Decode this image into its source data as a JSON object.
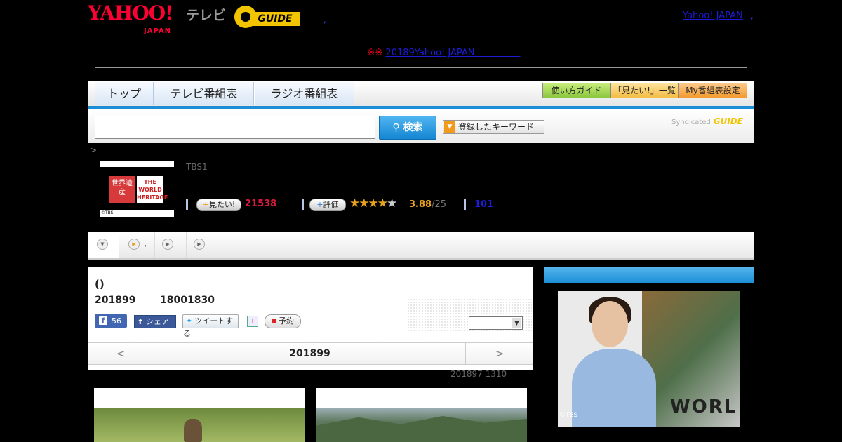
{
  "header": {
    "yahoo_logo": "YAHOO!",
    "yahoo_logo_sub": "JAPAN",
    "tv_label": "テレビ",
    "gguide_logo": "GUIDE",
    "sep1": ",",
    "yahoo_link": "Yahoo! JAPAN",
    "sep2": ","
  },
  "notice": {
    "mark": "※※",
    "link": "20189Yahoo! JAPAN　　　　　"
  },
  "nav": {
    "tabs": [
      "トップ",
      "テレビ番組表",
      "ラジオ番組表"
    ],
    "right_buttons": [
      "使い方ガイド",
      "「見たい!」一覧",
      "My番組表設定"
    ],
    "right_colors": [
      "#9bd04a",
      "#f6c85a",
      "#f4a33c"
    ]
  },
  "search": {
    "input_value": "",
    "select_value": "",
    "button_label": "検索",
    "keyword_button": "登録したキーワード",
    "syndicated": "Syndicated",
    "syndicated_logo": "GUIDE"
  },
  "program": {
    "breadcrumb": ">",
    "thumb_logo_left": "世界遺産",
    "thumb_logo_right": "THE WORLD HERITAGE",
    "thumb_credit": "©TBS",
    "channel": "TBS1",
    "mitai_label": "見たい!",
    "mitai_count": "21538",
    "hyouka_label": "評価",
    "rating": 3.88,
    "rating_text": "3.88",
    "rating_total": "/25",
    "review_count": "101"
  },
  "tabs2": {
    "items": [
      "",
      ",",
      "",
      ""
    ]
  },
  "main": {
    "title": "()",
    "date": "201899",
    "time": "18001830",
    "fb_like_count": "56",
    "fb_share": "シェア",
    "tweet": "ツイートする",
    "reserve": "予約",
    "episode_select": "",
    "pager_prev": "<",
    "pager_current": "201899",
    "pager_next": ">",
    "updated": "201897  1310"
  },
  "sidebar": {
    "promo_credit": "©TBS",
    "promo_word": "WORL"
  }
}
